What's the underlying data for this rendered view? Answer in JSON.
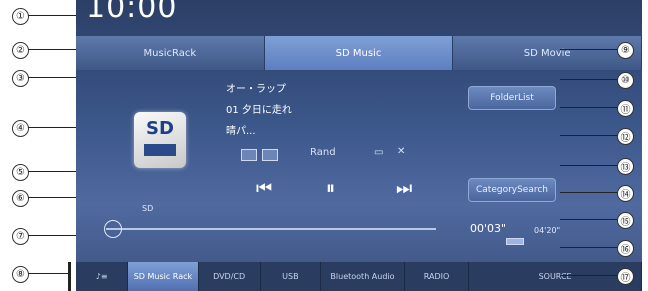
{
  "clock": "10:00",
  "tabs": [
    "MusicRack",
    "SD Music",
    "SD Movie"
  ],
  "track": {
    "artist": "オー・ラップ",
    "title": "01 夕日に走れ",
    "album": "晴パ..."
  },
  "buttons": {
    "folder_list": "FolderList",
    "category_search": "CategorySearch"
  },
  "play_mode": "Rand",
  "slider_label": "SD",
  "time": {
    "elapsed": "00'03\"",
    "total": "04'20\""
  },
  "bottom_tabs": [
    "SD Music Rack",
    "DVD/CD",
    "USB",
    "Bluetooth Audio",
    "RADIO",
    "SOURCE"
  ],
  "callouts": [
    "①",
    "②",
    "③",
    "④",
    "⑤",
    "⑥",
    "⑦",
    "⑧",
    "⑨",
    "⑩",
    "⑪",
    "⑫",
    "⑬",
    "⑭",
    "⑮",
    "⑯",
    "⑰"
  ],
  "colors": {
    "accent": "#5d7fc0",
    "background": "#3a5588"
  },
  "icons": [
    "sd-card-icon",
    "prev-track-icon",
    "pause-icon",
    "next-track-icon",
    "repeat-icon",
    "shuffle-icon",
    "music-list-icon"
  ]
}
